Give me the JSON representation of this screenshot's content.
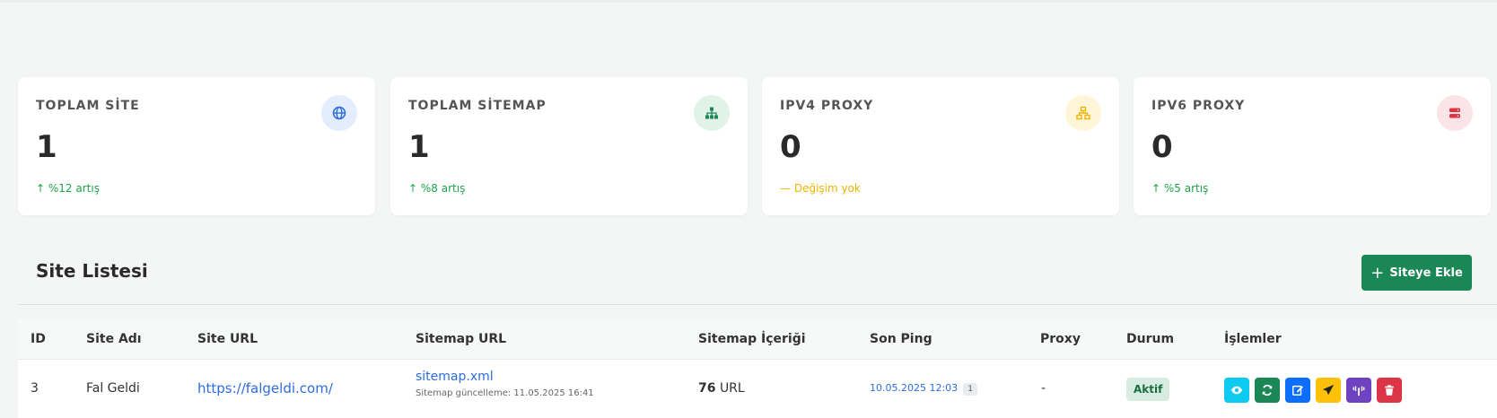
{
  "stats": [
    {
      "title": "TOPLAM SİTE",
      "value": "1",
      "trend_arrow": "↑",
      "trend": "%12 artış",
      "trend_color": "#1fa34a",
      "icon": "globe-icon",
      "icon_bg": "#e3edfd",
      "icon_color": "#2d6cdf"
    },
    {
      "title": "TOPLAM SİTEMAP",
      "value": "1",
      "trend_arrow": "↑",
      "trend": "%8 artış",
      "trend_color": "#1fa34a",
      "icon": "sitemap-icon",
      "icon_bg": "#e1f3e6",
      "icon_color": "#1a8754"
    },
    {
      "title": "IPV4 PROXY",
      "value": "0",
      "trend_arrow": "—",
      "trend": "Değişim yok",
      "trend_color": "#f0b400",
      "icon": "network-icon",
      "icon_bg": "#fff6d9",
      "icon_color": "#f0b400"
    },
    {
      "title": "IPV6 PROXY",
      "value": "0",
      "trend_arrow": "↑",
      "trend": "%5 artış",
      "trend_color": "#1fa34a",
      "icon": "server-icon",
      "icon_bg": "#fbe4e7",
      "icon_color": "#dc3545"
    }
  ],
  "section": {
    "title": "Site Listesi",
    "add_button": "Siteye Ekle",
    "add_icon": "+"
  },
  "table": {
    "headers": [
      "ID",
      "Site Adı",
      "Site URL",
      "Sitemap URL",
      "Sitemap İçeriği",
      "Son Ping",
      "Proxy",
      "Durum",
      "İşlemler"
    ],
    "rows": [
      {
        "id": "3",
        "name": "Fal Geldi",
        "url": "https://falgeldi.com/",
        "sitemap": "sitemap.xml",
        "sitemap_updated": "Sitemap güncelleme: 11.05.2025 16:41",
        "content_count": "76",
        "content_unit": "URL",
        "last_ping": "10.05.2025 12:03",
        "ping_count": "1",
        "proxy": "-",
        "status": "Aktif"
      }
    ]
  },
  "actions": [
    {
      "name": "view-icon",
      "color": "#0dcaf0"
    },
    {
      "name": "refresh-icon",
      "color": "#1a8754"
    },
    {
      "name": "edit-icon",
      "color": "#0d6efd"
    },
    {
      "name": "send-icon",
      "color": "#ffc107"
    },
    {
      "name": "ping-icon",
      "color": "#6f42c1"
    },
    {
      "name": "trash-icon",
      "color": "#dc3545"
    }
  ]
}
